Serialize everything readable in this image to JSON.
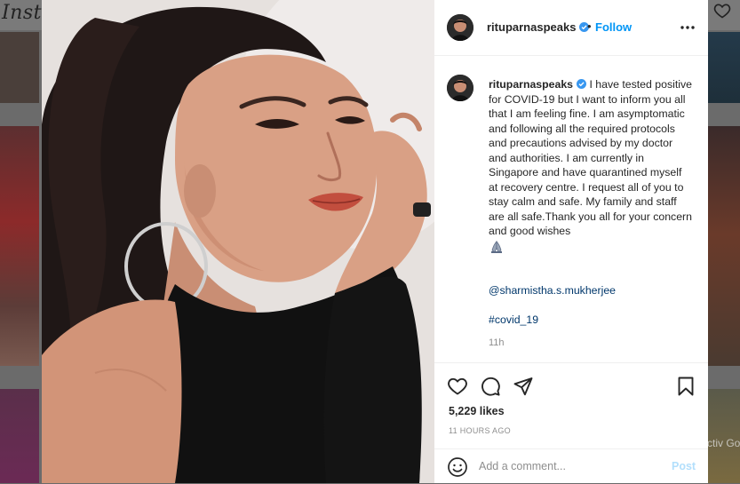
{
  "background": {
    "logo_text": "Insta",
    "activate_text": "Activ Go to"
  },
  "post": {
    "username": "rituparnaspeaks",
    "follow_label": "Follow",
    "header_separator": "•",
    "caption": "I have tested positive for COVID-19 but I want to inform you all that I am feeling fine. I am asymptomatic and following all the required protocols and precautions advised by my doctor and authorities. I am currently in Singapore and have quarantined myself at recovery centre. I request all of you to stay calm and safe. My family and staff are all safe.Thank you all for your concern and good wishes",
    "mention": "@sharmistha.s.mukherjee",
    "hashtag": "#covid_19",
    "caption_time": "11h",
    "likes": "5,229 likes",
    "time_ago": "11 HOURS AGO"
  },
  "comment_box": {
    "placeholder": "Add a comment...",
    "post_label": "Post"
  },
  "icons": {
    "verified": "verified-badge-icon",
    "more": "more-options-icon",
    "like": "heart-icon",
    "comment": "comment-bubble-icon",
    "share": "paper-plane-icon",
    "save": "bookmark-icon",
    "emoji": "smiley-icon",
    "pray": "folded-hands-icon"
  },
  "colors": {
    "link_blue": "#0095f6",
    "mention_blue": "#00376b",
    "text": "#262626",
    "muted": "#8e8e8e",
    "post_disabled": "#b2dffc",
    "verified": "#3897f0"
  }
}
